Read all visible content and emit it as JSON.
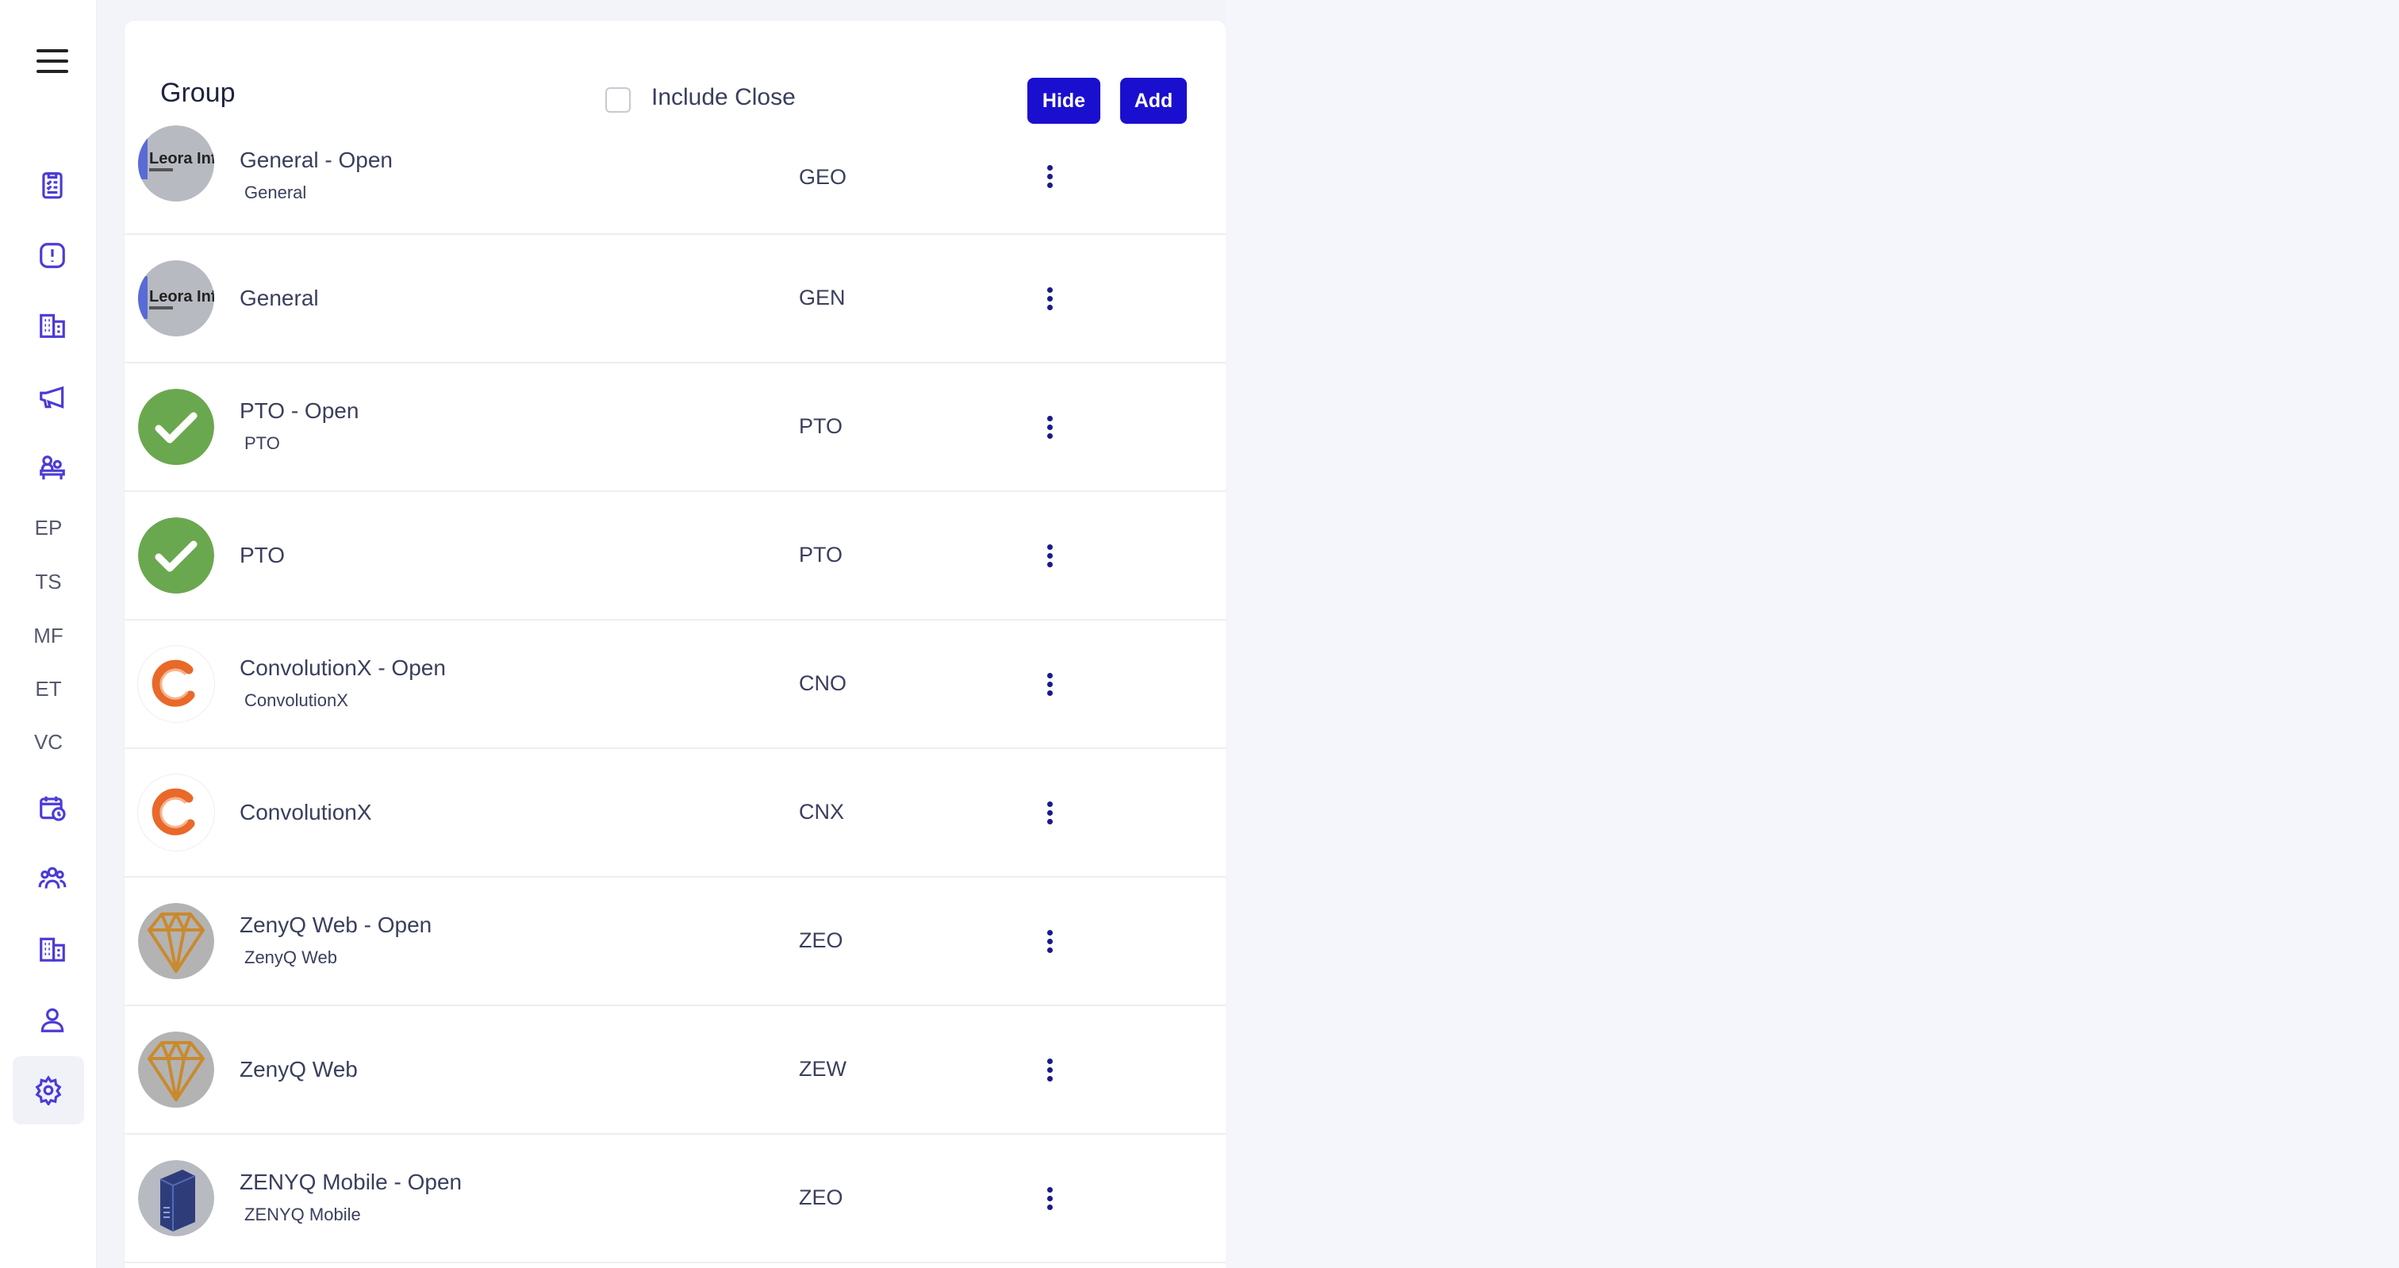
{
  "sidebar": {
    "items": [
      {
        "icon": "checklist-icon"
      },
      {
        "icon": "alert-icon"
      },
      {
        "icon": "building-icon"
      },
      {
        "icon": "megaphone-icon"
      },
      {
        "icon": "team-desk-icon"
      },
      {
        "label": "EP"
      },
      {
        "label": "TS"
      },
      {
        "label": "MF"
      },
      {
        "label": "ET"
      },
      {
        "label": "VC"
      },
      {
        "icon": "calendar-clock-icon"
      },
      {
        "icon": "people-group-icon"
      },
      {
        "icon": "office-building-icon"
      },
      {
        "icon": "user-icon"
      },
      {
        "icon": "gear-icon",
        "active": true
      }
    ]
  },
  "header": {
    "title": "Group",
    "include_close_label": "Include Close",
    "include_close_checked": false,
    "hide_label": "Hide",
    "add_label": "Add"
  },
  "rows": [
    {
      "name": "General - Open",
      "sub": "General",
      "code": "GEO",
      "avatar": "leora-logo"
    },
    {
      "name": "General",
      "sub": "",
      "code": "GEN",
      "avatar": "leora-logo"
    },
    {
      "name": "PTO - Open",
      "sub": "PTO",
      "code": "PTO",
      "avatar": "green-check"
    },
    {
      "name": "PTO",
      "sub": "",
      "code": "PTO",
      "avatar": "green-check"
    },
    {
      "name": "ConvolutionX - Open",
      "sub": "ConvolutionX",
      "code": "CNO",
      "avatar": "orange-c"
    },
    {
      "name": "ConvolutionX",
      "sub": "",
      "code": "CNX",
      "avatar": "orange-c"
    },
    {
      "name": "ZenyQ Web - Open",
      "sub": "ZenyQ Web",
      "code": "ZEO",
      "avatar": "diamond"
    },
    {
      "name": "ZenyQ Web",
      "sub": "",
      "code": "ZEW",
      "avatar": "diamond"
    },
    {
      "name": "ZENYQ Mobile - Open",
      "sub": "ZENYQ Mobile",
      "code": "ZEO",
      "avatar": "server-box"
    }
  ],
  "avatar_logo_text": "Leora Infotech",
  "colors": {
    "accent": "#1a0fcf",
    "sidebar_icon": "#4b3bd6",
    "green": "#6aa84f",
    "orange": "#e8692a"
  }
}
